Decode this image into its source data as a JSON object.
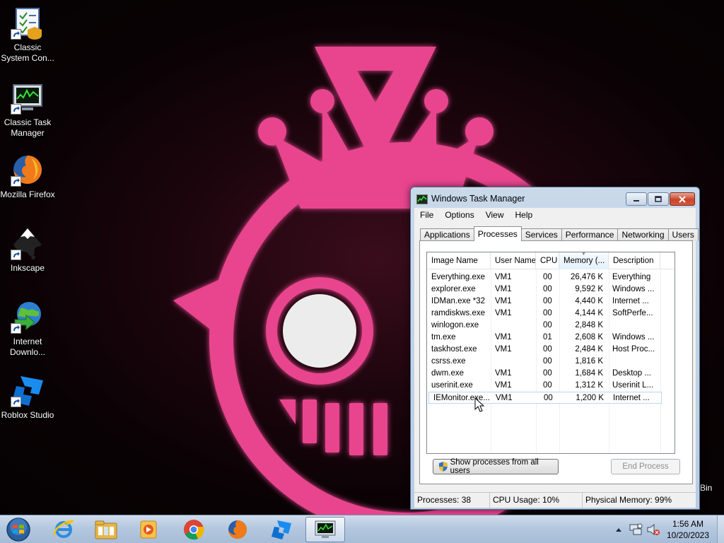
{
  "desktop": {
    "icons": [
      {
        "label": "Classic System Con...",
        "icon": "control-panel-icon"
      },
      {
        "label": "Classic Task Manager",
        "icon": "task-manager-icon"
      },
      {
        "label": "Mozilla Firefox",
        "icon": "firefox-icon"
      },
      {
        "label": "Inkscape",
        "icon": "inkscape-icon"
      },
      {
        "label": "Internet Downlo...",
        "icon": "internet-download-manager-icon"
      },
      {
        "label": "Roblox Studio",
        "icon": "roblox-studio-icon"
      }
    ],
    "partial_label": "Bin"
  },
  "task_manager": {
    "title": "Windows Task Manager",
    "menu": [
      "File",
      "Options",
      "View",
      "Help"
    ],
    "tabs": [
      "Applications",
      "Processes",
      "Services",
      "Performance",
      "Networking",
      "Users"
    ],
    "active_tab": "Processes",
    "columns": [
      "Image Name",
      "User Name",
      "CPU",
      "Memory (...",
      "Description"
    ],
    "sorted_column": "Memory (...",
    "processes": [
      {
        "name": "Everything.exe",
        "user": "VM1",
        "cpu": "00",
        "memory": "26,476 K",
        "description": "Everything"
      },
      {
        "name": "explorer.exe",
        "user": "VM1",
        "cpu": "00",
        "memory": "9,592 K",
        "description": "Windows ..."
      },
      {
        "name": "IDMan.exe *32",
        "user": "VM1",
        "cpu": "00",
        "memory": "4,440 K",
        "description": "Internet ..."
      },
      {
        "name": "ramdiskws.exe",
        "user": "VM1",
        "cpu": "00",
        "memory": "4,144 K",
        "description": "SoftPerfe..."
      },
      {
        "name": "winlogon.exe",
        "user": "",
        "cpu": "00",
        "memory": "2,848 K",
        "description": ""
      },
      {
        "name": "tm.exe",
        "user": "VM1",
        "cpu": "01",
        "memory": "2,608 K",
        "description": "Windows ..."
      },
      {
        "name": "taskhost.exe",
        "user": "VM1",
        "cpu": "00",
        "memory": "2,484 K",
        "description": "Host Proc..."
      },
      {
        "name": "csrss.exe",
        "user": "",
        "cpu": "00",
        "memory": "1,816 K",
        "description": ""
      },
      {
        "name": "dwm.exe",
        "user": "VM1",
        "cpu": "00",
        "memory": "1,684 K",
        "description": "Desktop ..."
      },
      {
        "name": "userinit.exe",
        "user": "VM1",
        "cpu": "00",
        "memory": "1,312 K",
        "description": "Userinit L..."
      },
      {
        "name": "IEMonitor.exe...",
        "user": "VM1",
        "cpu": "00",
        "memory": "1,200 K",
        "description": "Internet ..."
      }
    ],
    "selected_row": 10,
    "show_all_label": "Show processes from all users",
    "end_process_label": "End Process",
    "status": {
      "processes": "Processes: 38",
      "cpu_usage": "CPU Usage: 10%",
      "physical_memory": "Physical Memory: 99%"
    }
  },
  "taskbar": {
    "pinned": [
      "internet-explorer-icon",
      "windows-explorer-icon",
      "media-player-icon",
      "chrome-icon",
      "firefox-icon",
      "roblox-studio-icon",
      "task-manager-icon"
    ],
    "active": "task-manager-icon",
    "clock_time": "1:56 AM",
    "clock_date": "10/20/2023"
  },
  "colors": {
    "wallpaper_pink": "#e8448e",
    "wallpaper_bg": "#0a0204",
    "window_frame": "#bcd0e6",
    "close_red": "#c9452b",
    "selection_border": "#b7d7f3"
  }
}
